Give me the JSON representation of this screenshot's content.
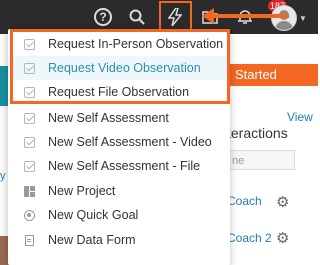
{
  "topbar": {
    "help_icon": "help-circle-icon",
    "search_icon": "search-icon",
    "bolt_icon": "lightning-bolt-icon",
    "folder_icon": "folder-icon",
    "bell_icon": "bell-icon",
    "notification_count": "187",
    "avatar": "user-avatar",
    "accent_color": "#f26722"
  },
  "menu": {
    "items": [
      {
        "label": "Request In-Person Observation",
        "icon": "checkbox-icon"
      },
      {
        "label": "Request Video Observation",
        "icon": "checkbox-icon",
        "active": true
      },
      {
        "label": "Request File Observation",
        "icon": "checkbox-icon"
      },
      {
        "label": "New Self Assessment",
        "icon": "checkbox-icon"
      },
      {
        "label": "New Self Assessment - Video",
        "icon": "checkbox-icon"
      },
      {
        "label": "New Self Assessment - File",
        "icon": "checkbox-icon"
      },
      {
        "label": "New Project",
        "icon": "project-icon"
      },
      {
        "label": "New Quick Goal",
        "icon": "goal-icon"
      },
      {
        "label": "New Data Form",
        "icon": "form-icon"
      }
    ]
  },
  "background": {
    "started_button": "Started",
    "view_link": "View",
    "interactions_title": "teractions",
    "name_field": "ne",
    "coach_1": "Coach",
    "coach_2": "Coach 2",
    "left_text": "y V"
  }
}
